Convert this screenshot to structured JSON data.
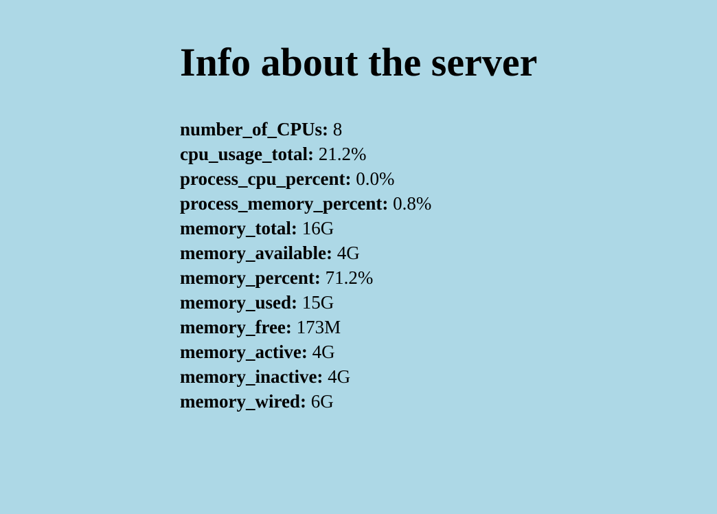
{
  "page": {
    "title": "Info about the server",
    "background_color": "#add8e6"
  },
  "info": [
    {
      "key": "number_of_CPUs:",
      "value": "8"
    },
    {
      "key": "cpu_usage_total:",
      "value": "21.2%"
    },
    {
      "key": "process_cpu_percent:",
      "value": "0.0%"
    },
    {
      "key": "process_memory_percent:",
      "value": "0.8%"
    },
    {
      "key": "memory_total:",
      "value": "16G"
    },
    {
      "key": "memory_available:",
      "value": "4G"
    },
    {
      "key": "memory_percent:",
      "value": "71.2%"
    },
    {
      "key": "memory_used:",
      "value": "15G"
    },
    {
      "key": "memory_free:",
      "value": "173M"
    },
    {
      "key": "memory_active:",
      "value": "4G"
    },
    {
      "key": "memory_inactive:",
      "value": "4G"
    },
    {
      "key": "memory_wired:",
      "value": "6G"
    }
  ]
}
